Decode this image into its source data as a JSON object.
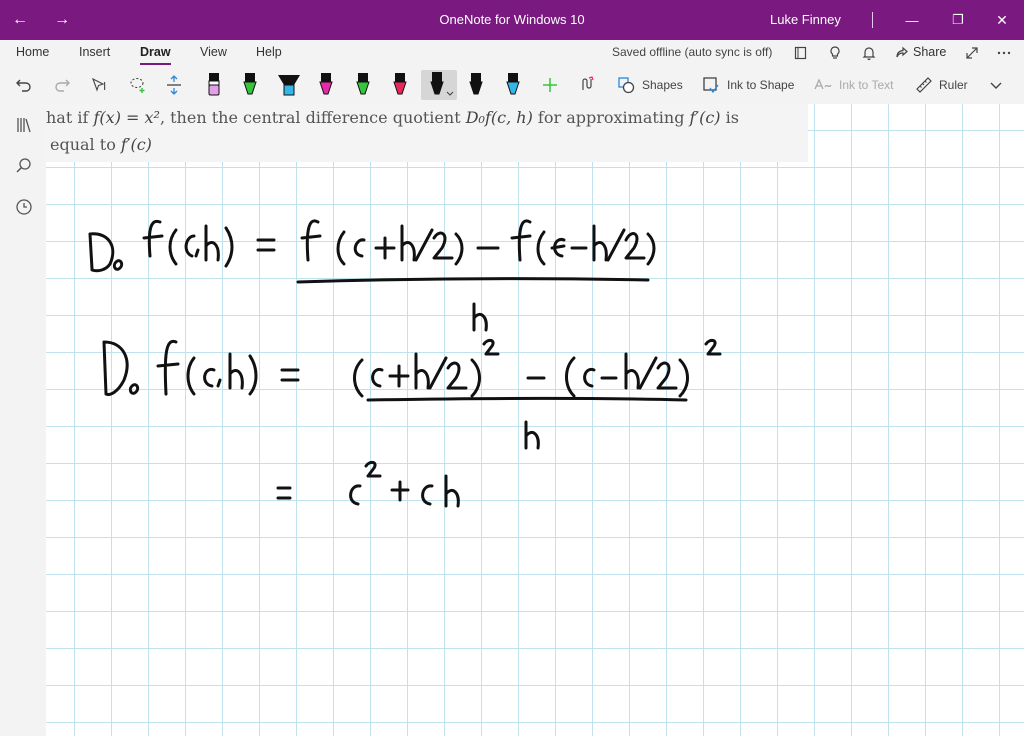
{
  "titlebar": {
    "title": "OneNote for Windows 10",
    "user": "Luke Finney",
    "back_glyph": "←",
    "forward_glyph": "→",
    "minimize_glyph": "—",
    "restore_glyph": "❐",
    "close_glyph": "✕"
  },
  "menu": {
    "tabs": [
      "Home",
      "Insert",
      "Draw",
      "View",
      "Help"
    ],
    "active_tab": "Draw",
    "status": "Saved offline (auto sync is off)",
    "share_label": "Share"
  },
  "toolbar": {
    "shapes_label": "Shapes",
    "ink_to_shape_label": "Ink to Shape",
    "ink_to_text_label": "Ink to Text",
    "ruler_label": "Ruler",
    "pens": [
      {
        "name": "highlighter-pink",
        "color": "#e2a0e6"
      },
      {
        "name": "pen-green",
        "color": "#35c43a"
      },
      {
        "name": "pen-cyan",
        "color": "#34b7e8"
      },
      {
        "name": "pen-magenta",
        "color": "#e62aa8"
      },
      {
        "name": "pen-green-2",
        "color": "#35c43a"
      },
      {
        "name": "pen-red",
        "color": "#e8285a"
      },
      {
        "name": "pen-black-selected",
        "color": "#111111"
      },
      {
        "name": "pen-black-2",
        "color": "#111111"
      },
      {
        "name": "pen-cyan-2",
        "color": "#34b7e8"
      }
    ]
  },
  "question": {
    "line1_prefix": "hat if",
    "fx": "f(x) = x²",
    "line1_mid": ", then the central difference quotient",
    "dquot": "D₀f(c, h)",
    "line1_after": "for approximating",
    "fprime": "f′(c)",
    "line1_end": "is",
    "line2_prefix": "equal to",
    "line2_fprime": "f′(c)"
  },
  "colors": {
    "accent": "#7a1a80",
    "grid": "#bfe3ee",
    "ink": "#111111"
  }
}
